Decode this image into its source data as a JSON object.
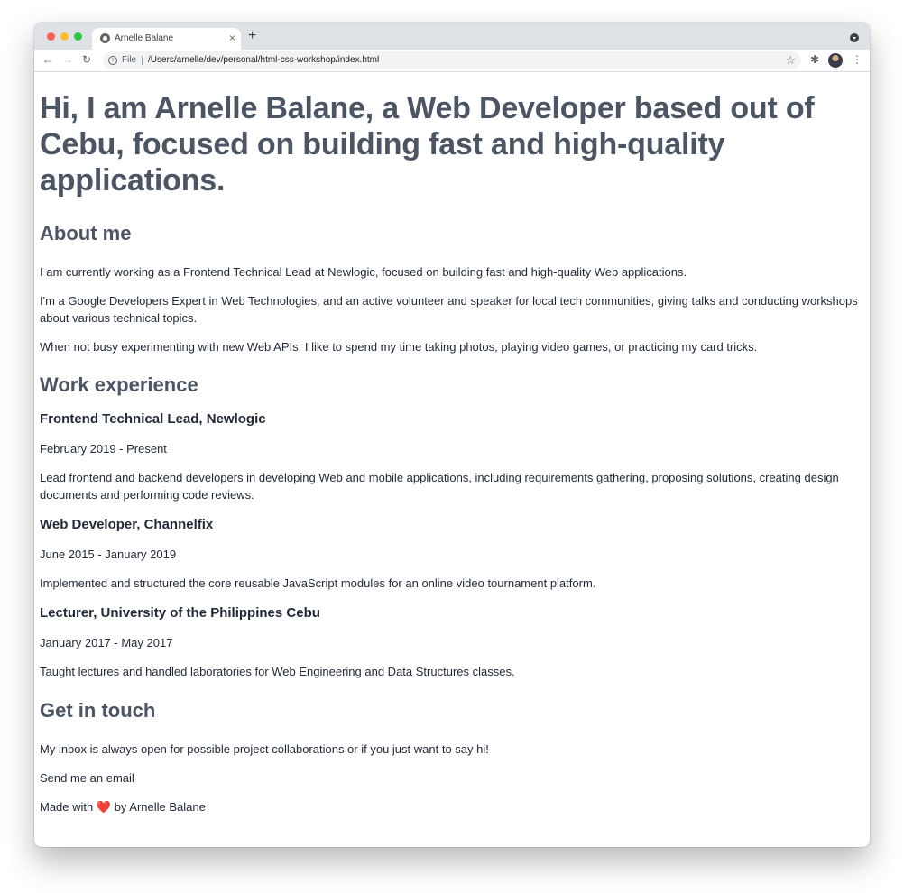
{
  "browser": {
    "tab_title": "Arnelle Balane",
    "tab_close": "×",
    "new_tab": "+",
    "scheme_label": "File",
    "url": "/Users/arnelle/dev/personal/html-css-workshop/index.html",
    "nav": {
      "back": "←",
      "forward": "→",
      "reload": "↻"
    },
    "star": "☆",
    "extensions": "✱",
    "kebab": "⋮",
    "info": "i"
  },
  "page": {
    "hero": "Hi, I am Arnelle Balane, a Web Developer based out of Cebu, focused on building fast and high-quality applications.",
    "about": {
      "heading": "About me",
      "paragraphs": [
        "I am currently working as a Frontend Technical Lead at Newlogic, focused on building fast and high-quality Web applications.",
        "I'm a Google Developers Expert in Web Technologies, and an active volunteer and speaker for local tech communities, giving talks and conducting workshops about various technical topics.",
        "When not busy experimenting with new Web APIs, I like to spend my time taking photos, playing video games, or practicing my card tricks."
      ]
    },
    "work": {
      "heading": "Work experience",
      "jobs": [
        {
          "title": "Frontend Technical Lead, Newlogic",
          "dates": "February 2019 - Present",
          "description": "Lead frontend and backend developers in developing Web and mobile applications, including requirements gathering, proposing solutions, creating design documents and performing code reviews."
        },
        {
          "title": "Web Developer, Channelfix",
          "dates": "June 2015 - January 2019",
          "description": "Implemented and structured the core reusable JavaScript modules for an online video tournament platform."
        },
        {
          "title": "Lecturer, University of the Philippines Cebu",
          "dates": "January 2017 - May 2017",
          "description": "Taught lectures and handled laboratories for Web Engineering and Data Structures classes."
        }
      ]
    },
    "contact": {
      "heading": "Get in touch",
      "text": "My inbox is always open for possible project collaborations or if you just want to say hi!",
      "email_link": "Send me an email"
    },
    "footer": {
      "made_with": "Made with",
      "heart": "❤️",
      "by": "by Arnelle Balane"
    }
  },
  "colors": {
    "heading": "#4b5563",
    "body_text": "#1f2937",
    "tabstrip": "#dee1e6",
    "heart": "#e02424"
  }
}
